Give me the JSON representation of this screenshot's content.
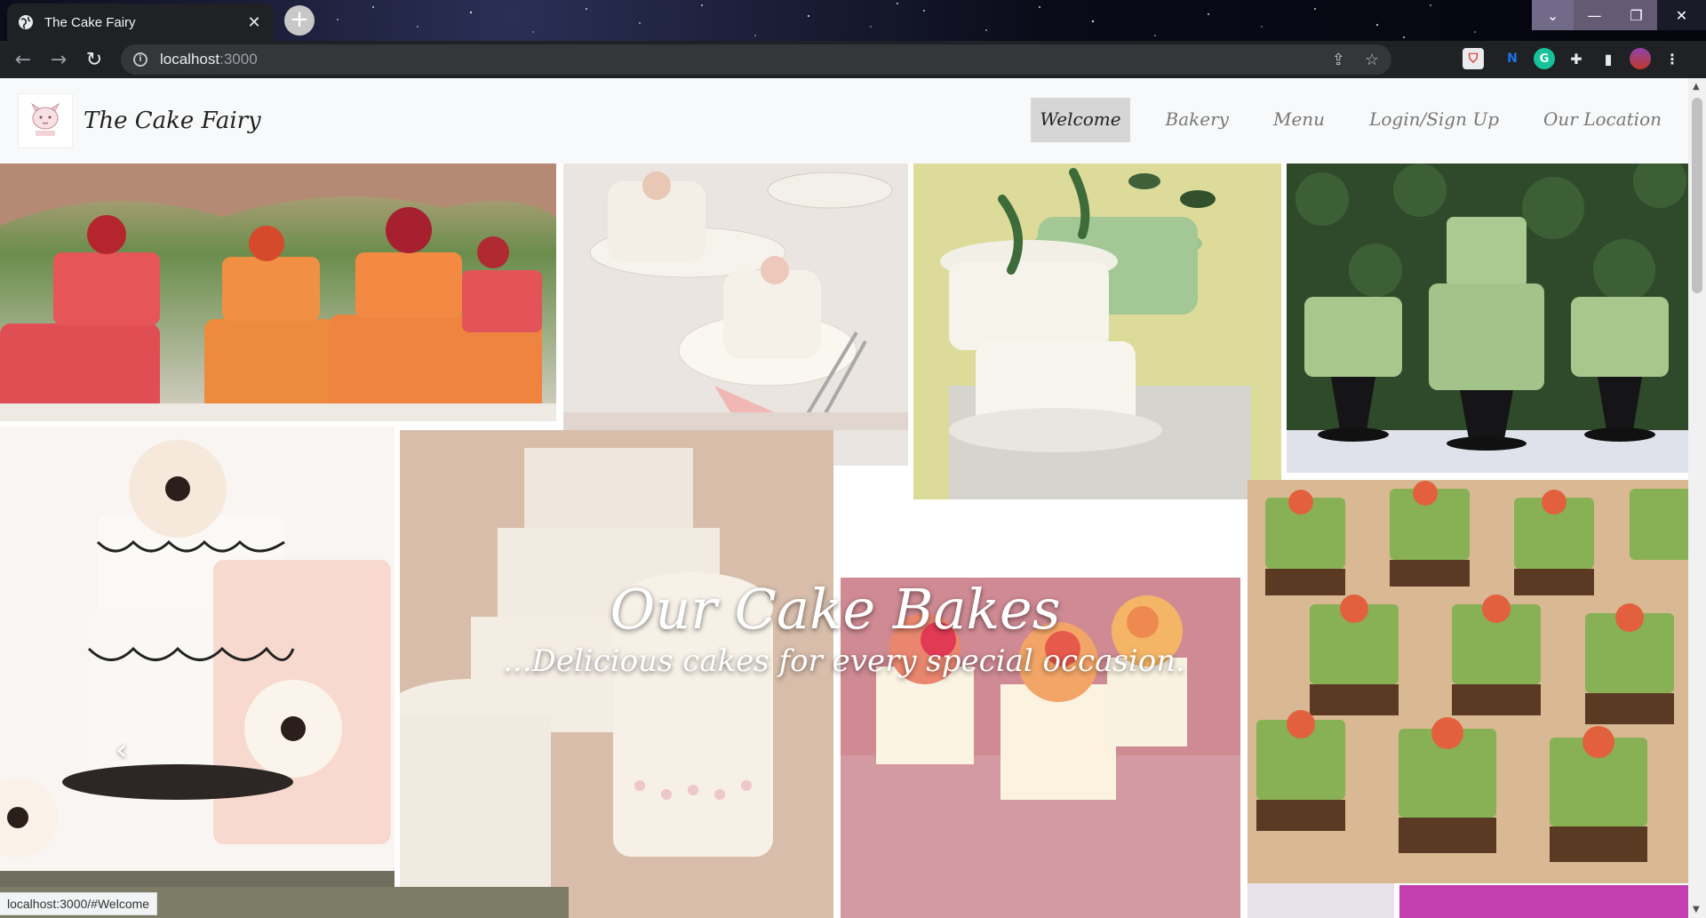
{
  "browser": {
    "tab_title": "The Cake Fairy",
    "url_host": "localhost",
    "url_port": ":3000",
    "status_url": "localhost:3000/#Welcome"
  },
  "site": {
    "brand": "The Cake Fairy",
    "nav": [
      {
        "label": "Welcome",
        "active": true
      },
      {
        "label": "Bakery",
        "active": false
      },
      {
        "label": "Menu",
        "active": false
      },
      {
        "label": "Login/Sign Up",
        "active": false
      },
      {
        "label": "Our Location",
        "active": false
      }
    ]
  },
  "carousel": {
    "title": "Our Cake Bakes",
    "subtitle": "...Delicious cakes for every special occasion."
  },
  "colors": {
    "nav_bg": "#f8f9fa",
    "active_bg": "#d6d6d6",
    "chrome_bg": "#202124"
  }
}
